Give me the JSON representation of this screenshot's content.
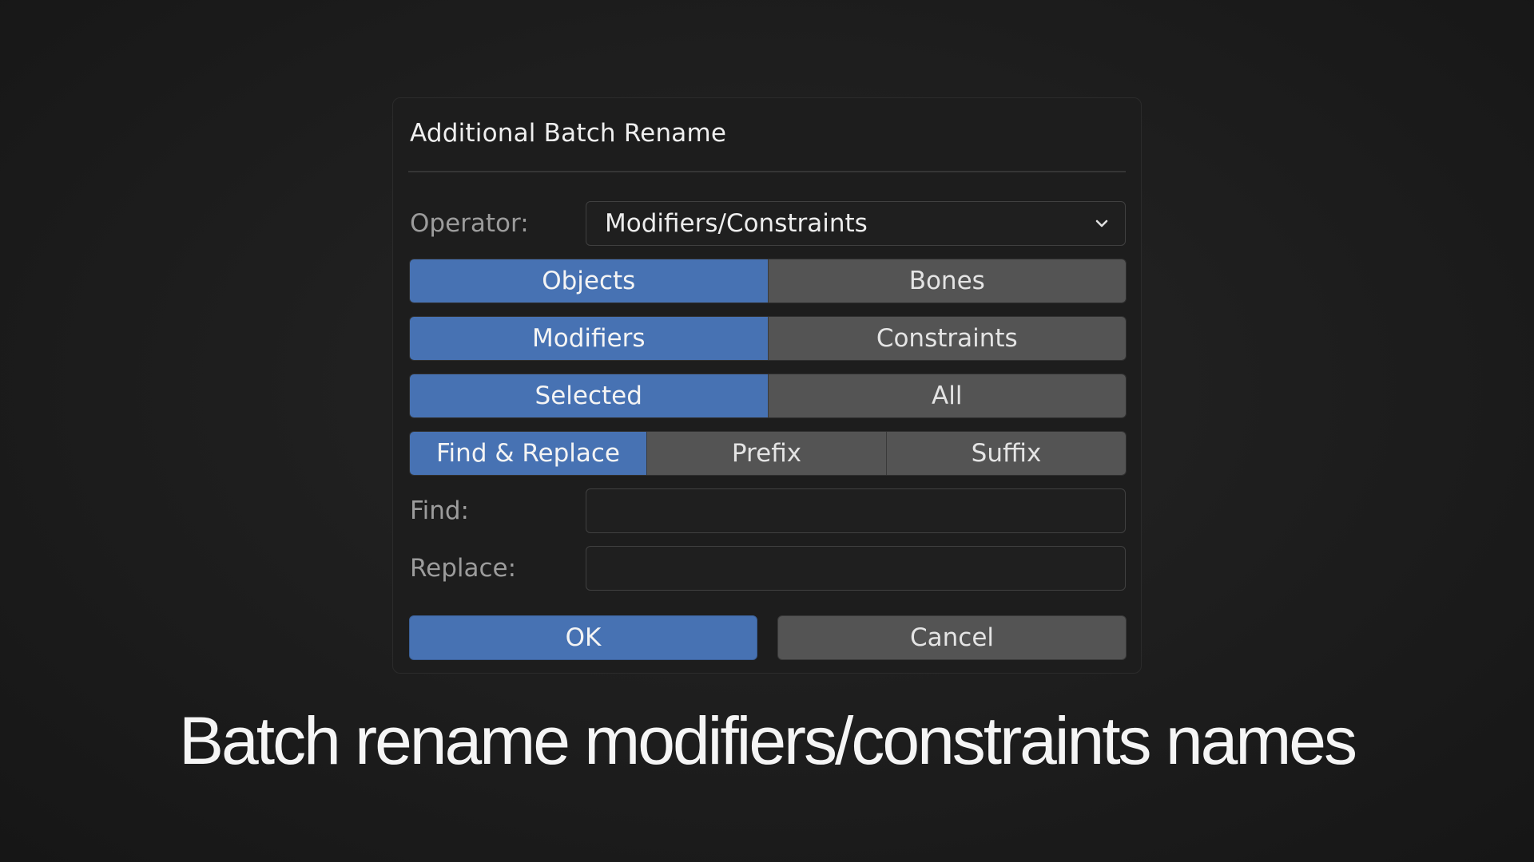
{
  "dialog": {
    "title": "Additional Batch Rename",
    "operator": {
      "label": "Operator:",
      "value": "Modifiers/Constraints",
      "icon": "chevron-down-icon"
    },
    "type_toggle": {
      "options": [
        "Objects",
        "Bones"
      ],
      "active": "Objects"
    },
    "data_toggle": {
      "options": [
        "Modifiers",
        "Constraints"
      ],
      "active": "Modifiers"
    },
    "scope_toggle": {
      "options": [
        "Selected",
        "All"
      ],
      "active": "Selected"
    },
    "mode_toggle": {
      "options": [
        "Find & Replace",
        "Prefix",
        "Suffix"
      ],
      "active": "Find & Replace"
    },
    "find": {
      "label": "Find:",
      "value": ""
    },
    "replace": {
      "label": "Replace:",
      "value": ""
    },
    "ok_label": "OK",
    "cancel_label": "Cancel"
  },
  "caption": "Batch rename modifiers/constraints names",
  "colors": {
    "accent": "#4772b3",
    "button": "#545454",
    "panel": "#1d1d1d",
    "background": "#1b1b1b"
  }
}
